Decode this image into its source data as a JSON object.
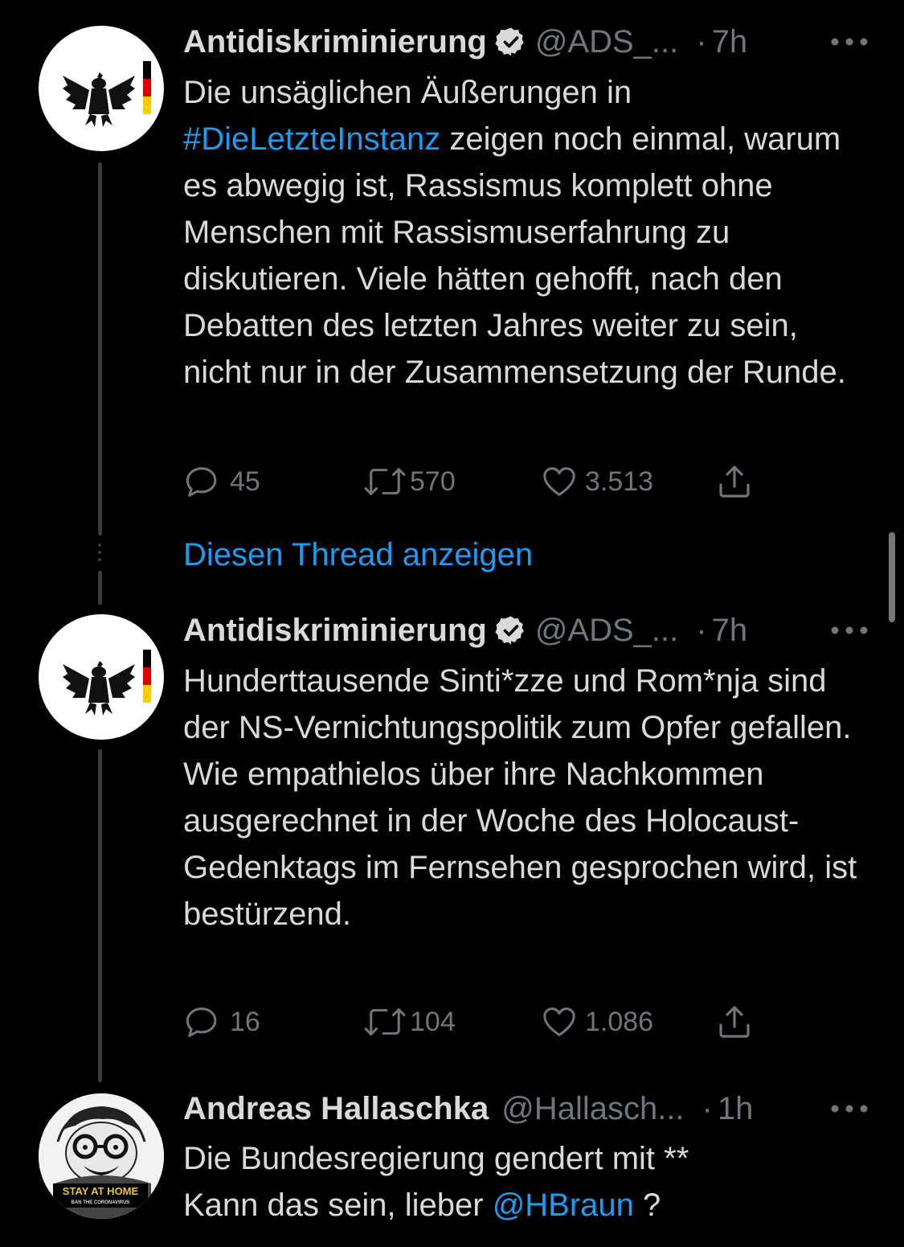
{
  "tweets": [
    {
      "author_name": "Antidiskriminierung",
      "handle": "@ADS_...",
      "separator": "·",
      "time": "7h",
      "text_parts": [
        "Die unsäglichen Äußerungen in",
        "#DieLetzteInstanz",
        " zeigen noch einmal, warum es abwegig ist, Rassismus komplett ohne Menschen mit Rassismuserfahrung zu diskutieren. Viele hätten gehofft, nach den Debatten des letzten Jahres weiter zu sein, nicht nur in der Zusammensetzung der Runde."
      ],
      "replies": "45",
      "retweets": "570",
      "likes": "3.513"
    },
    {
      "author_name": "Antidiskriminierung",
      "handle": "@ADS_...",
      "separator": "·",
      "time": "7h",
      "text_parts": [
        "Hunderttausende Sinti*zze und Rom*nja sind der NS-Vernichtungspolitik zum Opfer gefallen. Wie empathielos über ihre Nachkommen ausgerechnet in der Woche des Holocaust-Gedenktags im Fernsehen gesprochen wird, ist bestürzend."
      ],
      "replies": "16",
      "retweets": "104",
      "likes": "1.086"
    },
    {
      "author_name": "Andreas Hallaschka",
      "handle": "@Hallasch...",
      "separator": "·",
      "time": "1h",
      "text_parts": [
        "Die Bundesregierung gendert mit **",
        "Kann das sein, lieber ",
        "@HBraun",
        " ?"
      ],
      "avatar_text": [
        "STAY AT HOME",
        "BAN THE CORONAVIRUS"
      ]
    }
  ],
  "show_thread_label": "Diesen Thread anzeigen",
  "icons": {
    "reply": "reply-icon",
    "retweet": "retweet-icon",
    "like": "heart-icon",
    "share": "share-icon",
    "more": "more-icon",
    "verified": "verified-badge-icon"
  },
  "colors": {
    "background": "#000000",
    "text": "#d9d9d9",
    "muted": "#6e767d",
    "link": "#1d9bf0",
    "thread_line": "#3b3b3b"
  }
}
